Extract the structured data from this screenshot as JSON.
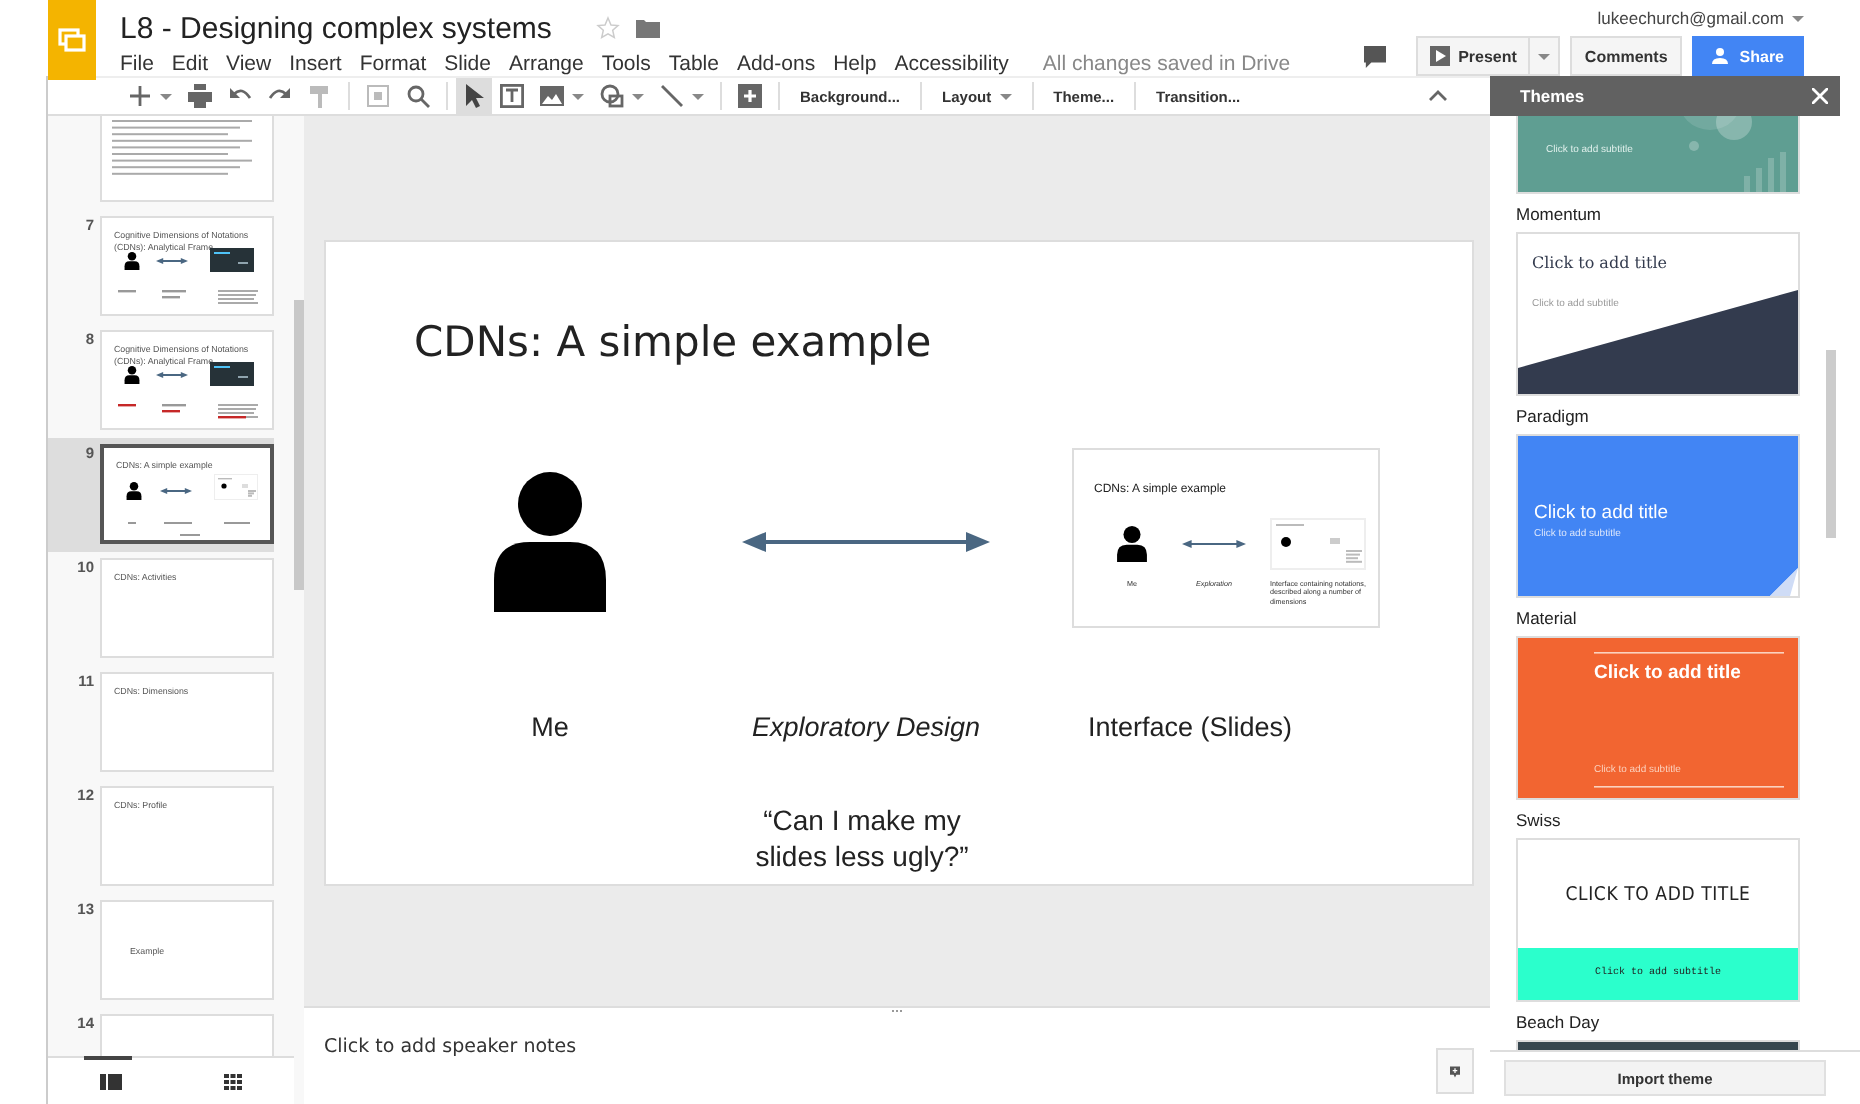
{
  "document": {
    "title": "L8 - Designing complex systems",
    "starred": false,
    "save_status": "All changes saved in Drive",
    "account": "lukeechurch@gmail.com"
  },
  "menu": [
    "File",
    "Edit",
    "View",
    "Insert",
    "Format",
    "Slide",
    "Arrange",
    "Tools",
    "Table",
    "Add-ons",
    "Help",
    "Accessibility"
  ],
  "buttons": {
    "present": "Present",
    "comments": "Comments",
    "share": "Share"
  },
  "toolbar": {
    "pointer_selected": true,
    "background": "Background...",
    "layout": "Layout",
    "theme": "Theme...",
    "transition": "Transition..."
  },
  "filmstrip": [
    {
      "kind": "bullets",
      "selected": false
    },
    {
      "number": "7",
      "title": "Cognitive Dimensions of Notations (CDNs): Analytical Frame",
      "kind": "diagram",
      "selected": false
    },
    {
      "number": "8",
      "title": "Cognitive Dimensions of Notations (CDNs): Analytical Frame",
      "kind": "diagram-marked",
      "selected": false
    },
    {
      "number": "9",
      "title": "CDNs: A simple example",
      "kind": "example",
      "selected": true
    },
    {
      "number": "10",
      "title": "CDNs: Activities",
      "kind": "title",
      "selected": false
    },
    {
      "number": "11",
      "title": "CDNs: Dimensions",
      "kind": "title",
      "selected": false
    },
    {
      "number": "12",
      "title": "CDNs: Profile",
      "kind": "title",
      "selected": false
    },
    {
      "number": "13",
      "title": "Example",
      "kind": "section",
      "selected": false
    },
    {
      "number": "14",
      "kind": "partial",
      "selected": false
    }
  ],
  "slide": {
    "title": "CDNs: A simple example",
    "left_label": "Me",
    "middle_label": "Exploratory Design",
    "right_label": "Interface (Slides)",
    "quote": "“Can I make my slides less ugly?”",
    "inset": {
      "title": "CDNs: A simple example",
      "left_label": "Me",
      "middle_label": "Exploration",
      "right_label": "Interface containing notations, described along a number of dimensions"
    }
  },
  "speaker_notes": {
    "placeholder": "Click to add speaker notes"
  },
  "themes": {
    "title": "Themes",
    "items": [
      {
        "kind": "momentum",
        "name": "Momentum",
        "subtitle": "Click to add subtitle"
      },
      {
        "kind": "paradigm",
        "name": "Paradigm",
        "preview_title": "Click to add title",
        "subtitle": "Click to add subtitle"
      },
      {
        "kind": "material",
        "name": "Material",
        "preview_title": "Click to add title",
        "subtitle": "Click to add subtitle"
      },
      {
        "kind": "swiss",
        "name": "Swiss",
        "preview_title": "Click to add title",
        "subtitle": "Click to add subtitle"
      },
      {
        "kind": "beach",
        "name": "Beach Day",
        "preview_title": "CLICK TO ADD TITLE",
        "subtitle": "Click to add subtitle"
      },
      {
        "kind": "dark"
      }
    ],
    "import_button": "Import theme"
  }
}
